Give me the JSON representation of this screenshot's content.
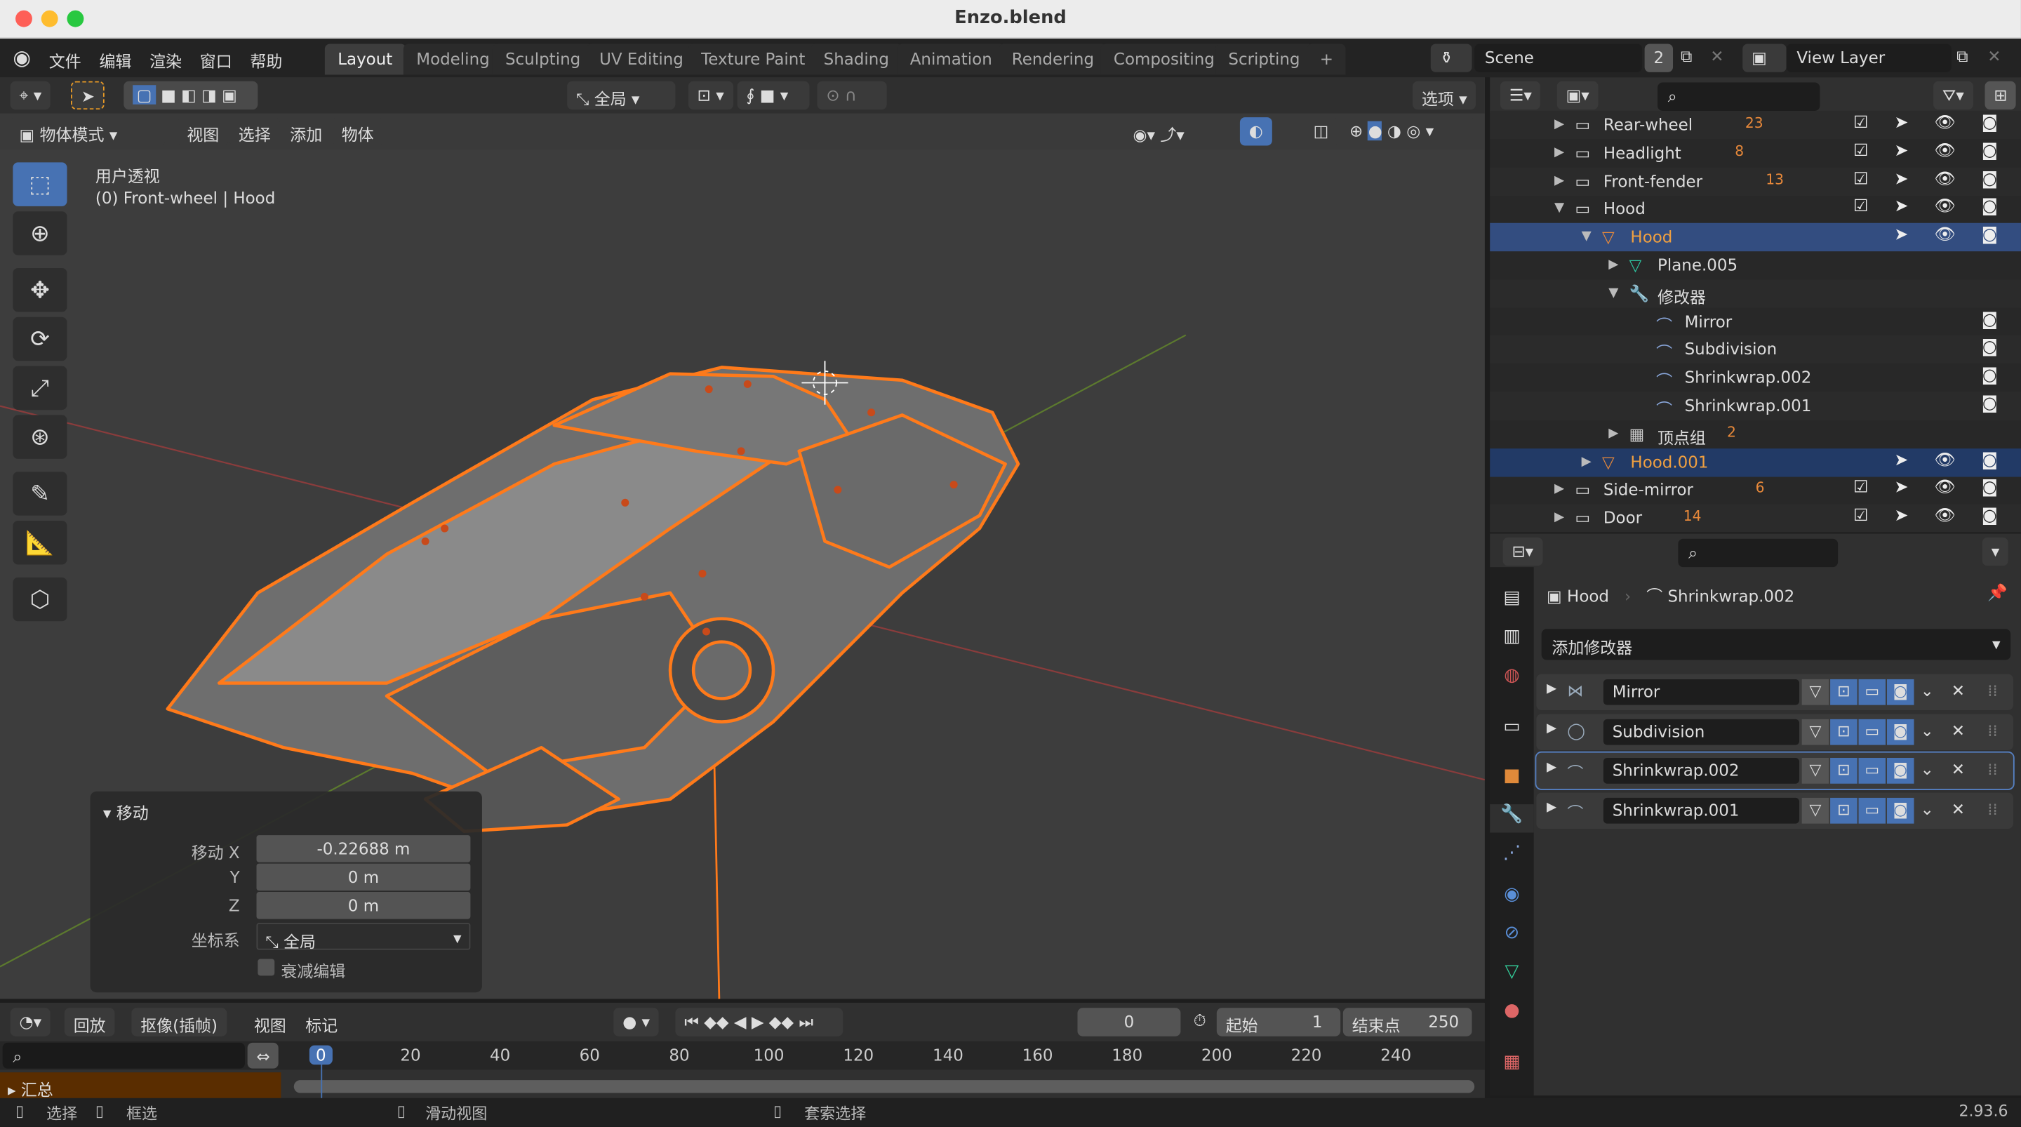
{
  "window": {
    "title": "Enzo.blend"
  },
  "menu": [
    "文件",
    "编辑",
    "渲染",
    "窗口",
    "帮助"
  ],
  "workspaces": [
    "Layout",
    "Modeling",
    "Sculpting",
    "UV Editing",
    "Texture Paint",
    "Shading",
    "Animation",
    "Rendering",
    "Compositing",
    "Scripting"
  ],
  "active_workspace": "Layout",
  "scene": {
    "name": "Scene",
    "users": "2"
  },
  "view_layer": "View Layer",
  "viewport": {
    "transform_orientation": "全局",
    "options_label": "选项",
    "mode": "物体模式",
    "menus": [
      "视图",
      "选择",
      "添加",
      "物体"
    ],
    "overlay_title": "用户透视",
    "overlay_object": "(0) Front-wheel | Hood"
  },
  "operator_panel": {
    "title": "移动",
    "rows": [
      {
        "label": "移动 X",
        "value": "-0.22688 m"
      },
      {
        "label": "Y",
        "value": "0 m"
      },
      {
        "label": "Z",
        "value": "0 m"
      }
    ],
    "orientation_label": "坐标系",
    "orientation_value": "全局",
    "falloff_label": "衰减编辑",
    "falloff_checked": false
  },
  "outliner": {
    "rows": [
      {
        "name": "Rear-wheel",
        "type": "collection",
        "badge": "23",
        "indent": 0
      },
      {
        "name": "Headlight",
        "type": "collection",
        "badge": "8",
        "indent": 0
      },
      {
        "name": "Front-fender",
        "type": "collection",
        "badge": "13",
        "indent": 0
      },
      {
        "name": "Hood",
        "type": "collection",
        "badge": "",
        "indent": 0,
        "expanded": true
      },
      {
        "name": "Hood",
        "type": "object",
        "indent": 1,
        "expanded": true,
        "selected": true
      },
      {
        "name": "Plane.005",
        "type": "mesh",
        "indent": 2
      },
      {
        "name": "修改器",
        "type": "modifiers",
        "indent": 2,
        "expanded": true
      },
      {
        "name": "Mirror",
        "type": "modifier",
        "indent": 3
      },
      {
        "name": "Subdivision",
        "type": "modifier",
        "indent": 3
      },
      {
        "name": "Shrinkwrap.002",
        "type": "modifier",
        "indent": 3
      },
      {
        "name": "Shrinkwrap.001",
        "type": "modifier",
        "indent": 3
      },
      {
        "name": "顶点组",
        "type": "vgroups",
        "badge": "2",
        "indent": 2
      },
      {
        "name": "Hood.001",
        "type": "object",
        "indent": 1,
        "selected2": true
      },
      {
        "name": "Side-mirror",
        "type": "collection",
        "badge": "6",
        "indent": 0
      },
      {
        "name": "Door",
        "type": "collection",
        "badge": "14",
        "indent": 0
      }
    ]
  },
  "properties": {
    "breadcrumb": [
      "Hood",
      "Shrinkwrap.002"
    ],
    "add_modifier": "添加修改器",
    "modifiers": [
      "Mirror",
      "Subdivision",
      "Shrinkwrap.002",
      "Shrinkwrap.001"
    ],
    "active_modifier": "Shrinkwrap.002"
  },
  "timeline": {
    "menus": [
      "回放",
      "抠像(插帧)",
      "视图",
      "标记"
    ],
    "current_frame": "0",
    "start_label": "起始",
    "start": "1",
    "end_label": "结束点",
    "end": "250",
    "ticks": [
      "0",
      "20",
      "40",
      "60",
      "80",
      "100",
      "120",
      "140",
      "160",
      "180",
      "200",
      "220",
      "240"
    ],
    "channel": "汇总"
  },
  "status": {
    "items": [
      "选择",
      "框选",
      "滑动视图",
      "套索选择"
    ],
    "version": "2.93.6"
  },
  "colors": {
    "accent": "#4772b3",
    "selection": "#ff7a1a",
    "outliner_selected": "#334d80"
  }
}
